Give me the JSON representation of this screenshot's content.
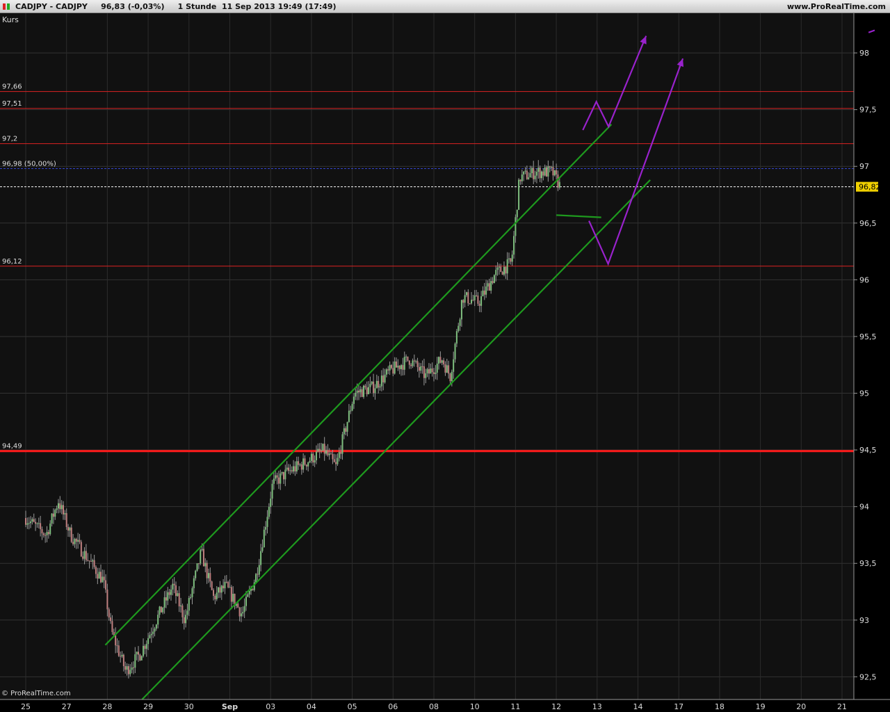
{
  "header": {
    "instrument": "CADJPY - CADJPY",
    "last": "96,83",
    "change": "(-0,03%)",
    "timeframe": "1 Stunde",
    "datetime": "11 Sep 2013 19:49 (17:49)",
    "site": "www.ProRealTime.com",
    "colors": {
      "red": "#dd2222",
      "green": "#22aa22"
    }
  },
  "panel_label": "Kurs",
  "copyright": "© ProRealTime.com",
  "chart_data": {
    "type": "candlestick",
    "ylim": [
      92.3,
      98.35
    ],
    "y_ticks": [
      {
        "value": 92.5,
        "label": "92,5"
      },
      {
        "value": 93,
        "label": "93"
      },
      {
        "value": 93.5,
        "label": "93,5"
      },
      {
        "value": 94,
        "label": "94"
      },
      {
        "value": 94.5,
        "label": "94,5"
      },
      {
        "value": 95,
        "label": "95"
      },
      {
        "value": 95.5,
        "label": "95,5"
      },
      {
        "value": 96,
        "label": "96"
      },
      {
        "value": 96.5,
        "label": "96,5"
      },
      {
        "value": 97,
        "label": "97"
      },
      {
        "value": 97.5,
        "label": "97,5"
      },
      {
        "value": 98,
        "label": "98"
      }
    ],
    "x_labels": [
      "25",
      "27",
      "28",
      "29",
      "30",
      "Sep",
      "03",
      "04",
      "05",
      "06",
      "08",
      "10",
      "11",
      "12",
      "13",
      "14",
      "17",
      "18",
      "19",
      "20",
      "21"
    ],
    "current_price": {
      "value": 96.82,
      "label": "96,82"
    },
    "levels": [
      {
        "value": 97.66,
        "label": "97,66",
        "color": "#dd2222",
        "style": "thin"
      },
      {
        "value": 97.51,
        "label": "97,51",
        "color": "#dd2222",
        "style": "thin"
      },
      {
        "value": 97.2,
        "label": "97,2",
        "color": "#dd2222",
        "style": "thin"
      },
      {
        "value": 96.98,
        "label": "96,98 (50,00%)",
        "color": "#3344cc",
        "style": "dashed"
      },
      {
        "value": 96.12,
        "label": "96,12",
        "color": "#dd2222",
        "style": "thin"
      },
      {
        "value": 94.49,
        "label": "94,49",
        "color": "#ff1a1a",
        "style": "thick"
      }
    ],
    "price_path": [
      {
        "x": 0,
        "y": 93.9
      },
      {
        "x": 0.5,
        "y": 93.75
      },
      {
        "x": 0.8,
        "y": 94.05
      },
      {
        "x": 1.1,
        "y": 93.75
      },
      {
        "x": 1.5,
        "y": 93.55
      },
      {
        "x": 1.9,
        "y": 93.35
      },
      {
        "x": 2.1,
        "y": 92.9
      },
      {
        "x": 2.45,
        "y": 92.55
      },
      {
        "x": 2.8,
        "y": 92.7
      },
      {
        "x": 3.2,
        "y": 93.0
      },
      {
        "x": 3.6,
        "y": 93.3
      },
      {
        "x": 3.9,
        "y": 93.0
      },
      {
        "x": 4.3,
        "y": 93.6
      },
      {
        "x": 4.6,
        "y": 93.2
      },
      {
        "x": 4.9,
        "y": 93.3
      },
      {
        "x": 5.3,
        "y": 93.05
      },
      {
        "x": 5.65,
        "y": 93.4
      },
      {
        "x": 6.05,
        "y": 94.2
      },
      {
        "x": 6.4,
        "y": 94.3
      },
      {
        "x": 6.9,
        "y": 94.4
      },
      {
        "x": 7.3,
        "y": 94.5
      },
      {
        "x": 7.6,
        "y": 94.35
      },
      {
        "x": 8.05,
        "y": 95.0
      },
      {
        "x": 8.5,
        "y": 95.05
      },
      {
        "x": 8.95,
        "y": 95.2
      },
      {
        "x": 9.4,
        "y": 95.3
      },
      {
        "x": 9.8,
        "y": 95.15
      },
      {
        "x": 10.2,
        "y": 95.3
      },
      {
        "x": 10.4,
        "y": 95.15
      },
      {
        "x": 10.7,
        "y": 95.85
      },
      {
        "x": 11.1,
        "y": 95.8
      },
      {
        "x": 11.5,
        "y": 96.05
      },
      {
        "x": 11.9,
        "y": 96.15
      },
      {
        "x": 12.1,
        "y": 96.9
      },
      {
        "x": 12.5,
        "y": 96.95
      },
      {
        "x": 12.9,
        "y": 96.95
      },
      {
        "x": 13.1,
        "y": 96.82
      }
    ],
    "trend_lines": [
      {
        "color": "#1e9a1e",
        "points": [
          {
            "x": 1.95,
            "y": 92.78
          },
          {
            "x": 14.35,
            "y": 97.37
          }
        ]
      },
      {
        "color": "#1e9a1e",
        "points": [
          {
            "x": 2.85,
            "y": 92.3
          },
          {
            "x": 15.3,
            "y": 96.88
          }
        ]
      },
      {
        "color": "#1e9a1e",
        "points": [
          {
            "x": 13.0,
            "y": 96.57
          },
          {
            "x": 14.1,
            "y": 96.55
          }
        ]
      }
    ],
    "projections": [
      {
        "color": "#9922cc",
        "points": [
          {
            "x": 13.65,
            "y": 97.32
          },
          {
            "x": 13.98,
            "y": 97.57
          },
          {
            "x": 14.28,
            "y": 97.35
          },
          {
            "x": 15.2,
            "y": 98.15
          }
        ]
      },
      {
        "color": "#9922cc",
        "points": [
          {
            "x": 13.8,
            "y": 96.52
          },
          {
            "x": 14.27,
            "y": 96.14
          },
          {
            "x": 16.1,
            "y": 97.95
          }
        ]
      },
      {
        "color": "#9922cc",
        "points": [
          {
            "x": 20.65,
            "y": 98.18
          },
          {
            "x": 20.8,
            "y": 98.2
          }
        ]
      }
    ]
  }
}
